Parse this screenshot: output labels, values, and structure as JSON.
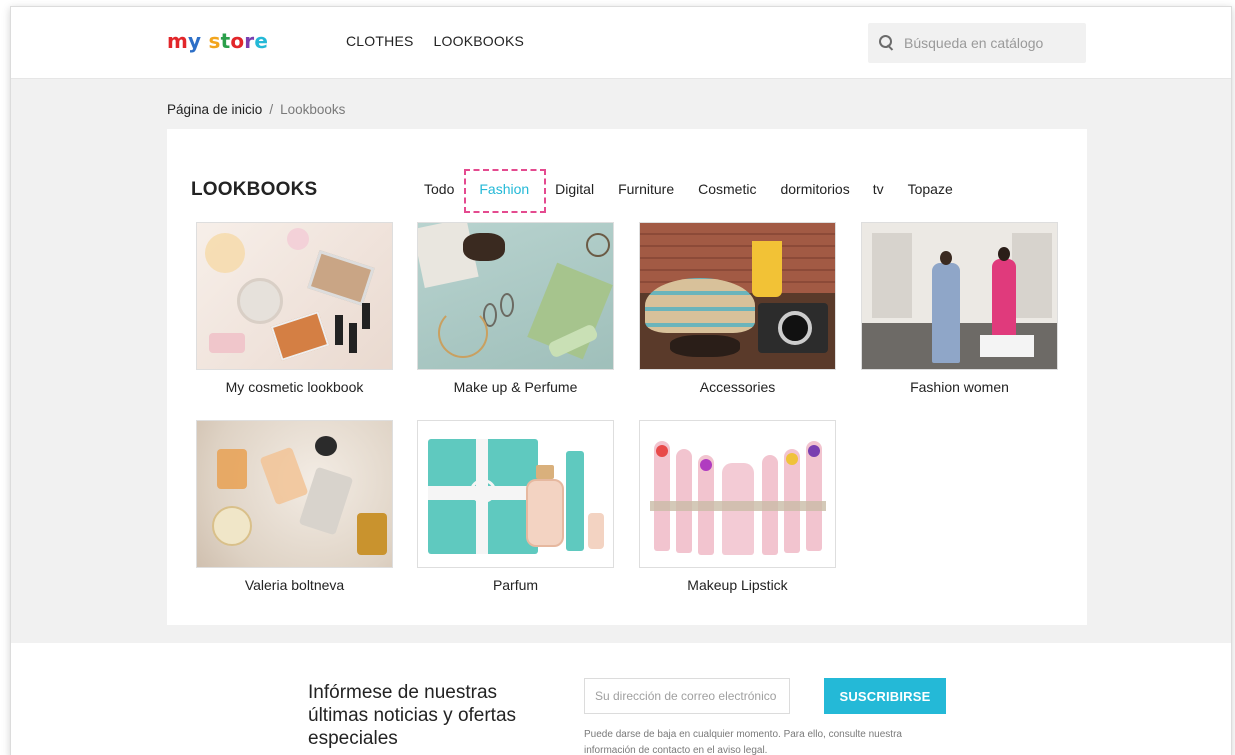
{
  "header": {
    "logo": {
      "letters": [
        "m",
        "y",
        " ",
        "s",
        "t",
        "o",
        "r",
        "e"
      ],
      "colors": [
        "#e2262a",
        "#2d6fc7",
        "#ffffff",
        "#f2a51d",
        "#2a9f4a",
        "#e2262a",
        "#7a3fb0",
        "#24b9d7"
      ]
    },
    "nav": [
      "CLOTHES",
      "LOOKBOOKS"
    ],
    "search": {
      "placeholder": "Búsqueda en catálogo"
    }
  },
  "breadcrumb": {
    "home": "Página de inicio",
    "separator": "/",
    "current": "Lookbooks"
  },
  "main": {
    "title": "LOOKBOOKS",
    "filters": [
      {
        "label": "Todo",
        "active": false
      },
      {
        "label": "Fashion",
        "active": true
      },
      {
        "label": "Digital",
        "active": false
      },
      {
        "label": "Furniture",
        "active": false
      },
      {
        "label": "Cosmetic",
        "active": false
      },
      {
        "label": "dormitorios",
        "active": false
      },
      {
        "label": "tv",
        "active": false
      },
      {
        "label": "Topaze",
        "active": false
      }
    ],
    "lookbooks": [
      {
        "label": "My cosmetic lookbook"
      },
      {
        "label": "Make up & Perfume"
      },
      {
        "label": "Accessories"
      },
      {
        "label": "Fashion women"
      },
      {
        "label": "Valeria boltneva"
      },
      {
        "label": "Parfum"
      },
      {
        "label": "Makeup Lipstick"
      }
    ]
  },
  "newsletter": {
    "text": "Infórmese de nuestras últimas noticias y ofertas especiales",
    "email_placeholder": "Su dirección de correo electrónico",
    "subscribe_label": "SUSCRIBIRSE",
    "note": "Puede darse de baja en cualquier momento. Para ello, consulte nuestra información de contacto en el aviso legal."
  },
  "colors": {
    "accent": "#24b9d7",
    "highlight": "#e44a8f",
    "text": "#232323"
  }
}
